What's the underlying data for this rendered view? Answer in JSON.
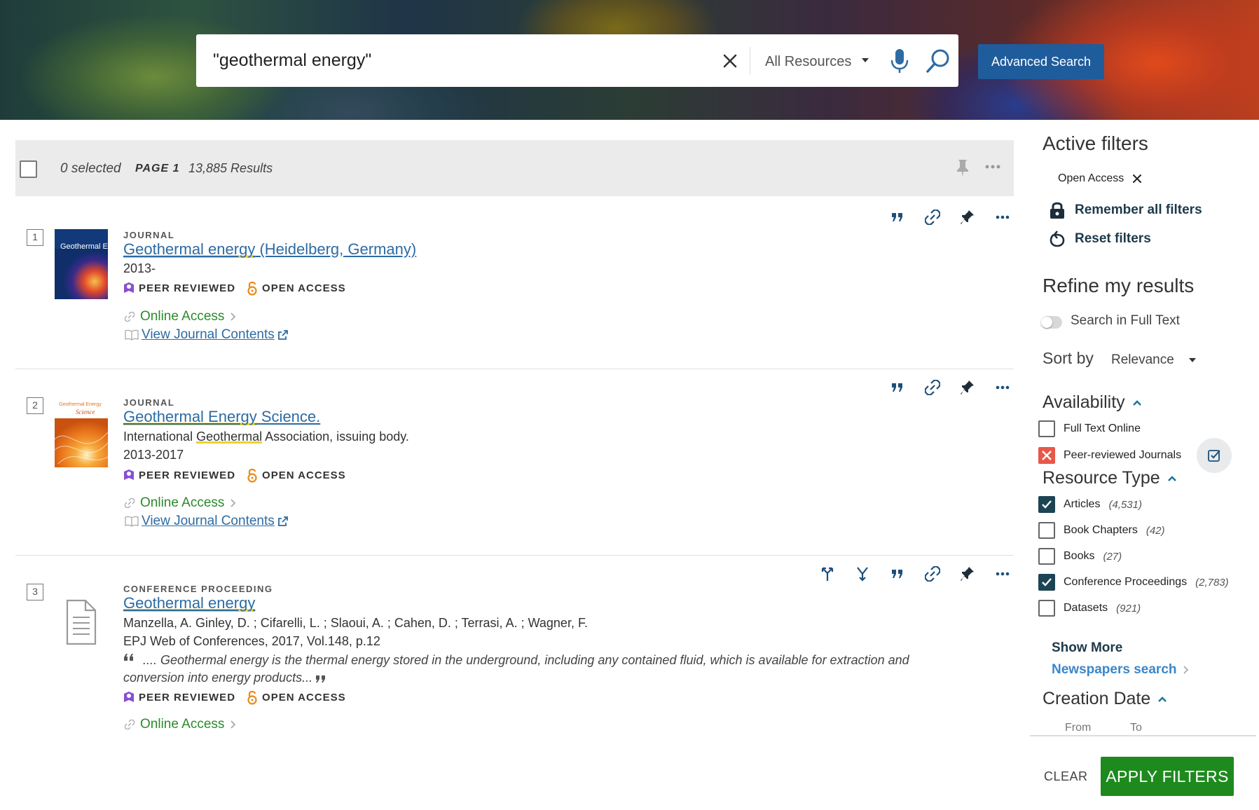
{
  "search": {
    "query": "\"geothermal energy\"",
    "scope": "All Resources",
    "advanced_label": "Advanced Search"
  },
  "results_bar": {
    "selected": "0 selected",
    "page": "PAGE 1",
    "total": "13,885 Results"
  },
  "results": [
    {
      "number": "1",
      "type": "JOURNAL",
      "title_part1": "Geothermal energy",
      "title_part2": " (Heidelberg, Germany)",
      "line1": "2013-",
      "cover_title": "Geothermal Energy",
      "badge_peer": "PEER REVIEWED",
      "badge_open": "OPEN ACCESS",
      "online": "Online Access",
      "view": "View Journal Contents"
    },
    {
      "number": "2",
      "type": "JOURNAL",
      "title_part1": "Geothermal Energy",
      "title_part2": " Science.",
      "line1_pre": "International ",
      "line1_hl": "Geothermal",
      "line1_post": " Association, issuing body.",
      "line2": "2013-2017",
      "cover_title": "Geothermal Energy",
      "cover_sub": "Science",
      "badge_peer": "PEER REVIEWED",
      "badge_open": "OPEN ACCESS",
      "online": "Online Access",
      "view": "View Journal Contents"
    },
    {
      "number": "3",
      "type": "CONFERENCE PROCEEDING",
      "title": "Geothermal energy",
      "authors": "Manzella, A. Ginley, D. ; Cifarelli, L. ; Slaoui, A. ; Cahen, D. ; Terrasi, A. ; Wagner, F.",
      "source": "EPJ Web of Conferences, 2017, Vol.148, p.12",
      "snippet": ".... Geothermal energy is the thermal energy stored in the underground, including any contained fluid, which is available for extraction and conversion into energy products...",
      "badge_peer": "PEER REVIEWED",
      "badge_open": "OPEN ACCESS",
      "online": "Online Access"
    }
  ],
  "sidebar": {
    "active_filters_title": "Active filters",
    "active_chip": "Open Access",
    "remember": "Remember all filters",
    "reset": "Reset filters",
    "refine_title": "Refine my results",
    "fulltext_toggle": "Search in Full Text",
    "sort_by": "Sort by",
    "sort_value": "Relevance",
    "availability": {
      "title": "Availability",
      "items": [
        {
          "label": "Full Text Online",
          "state": "unchecked"
        },
        {
          "label": "Peer-reviewed Journals",
          "state": "excluded"
        }
      ]
    },
    "resource_type": {
      "title": "Resource Type",
      "items": [
        {
          "label": "Articles",
          "count": "(4,531)",
          "state": "checked"
        },
        {
          "label": "Book Chapters",
          "count": "(42)",
          "state": "unchecked"
        },
        {
          "label": "Books",
          "count": "(27)",
          "state": "unchecked"
        },
        {
          "label": "Conference Proceedings",
          "count": "(2,783)",
          "state": "checked"
        },
        {
          "label": "Datasets",
          "count": "(921)",
          "state": "unchecked"
        }
      ]
    },
    "show_more": "Show More",
    "newspapers": "Newspapers search",
    "creation_date": {
      "title": "Creation Date",
      "from": "From",
      "to": "To"
    },
    "clear": "CLEAR",
    "apply": "APPLY FILTERS"
  },
  "colors": {
    "primary": "#1f5c9b",
    "link": "#2d6ba3",
    "online": "#2b8a2b",
    "apply": "#1e8a1e",
    "dark_teal": "#1d4454",
    "exclude": "#e8584a",
    "peer_purple": "#8a4fd0",
    "open_orange": "#e88a1a"
  }
}
